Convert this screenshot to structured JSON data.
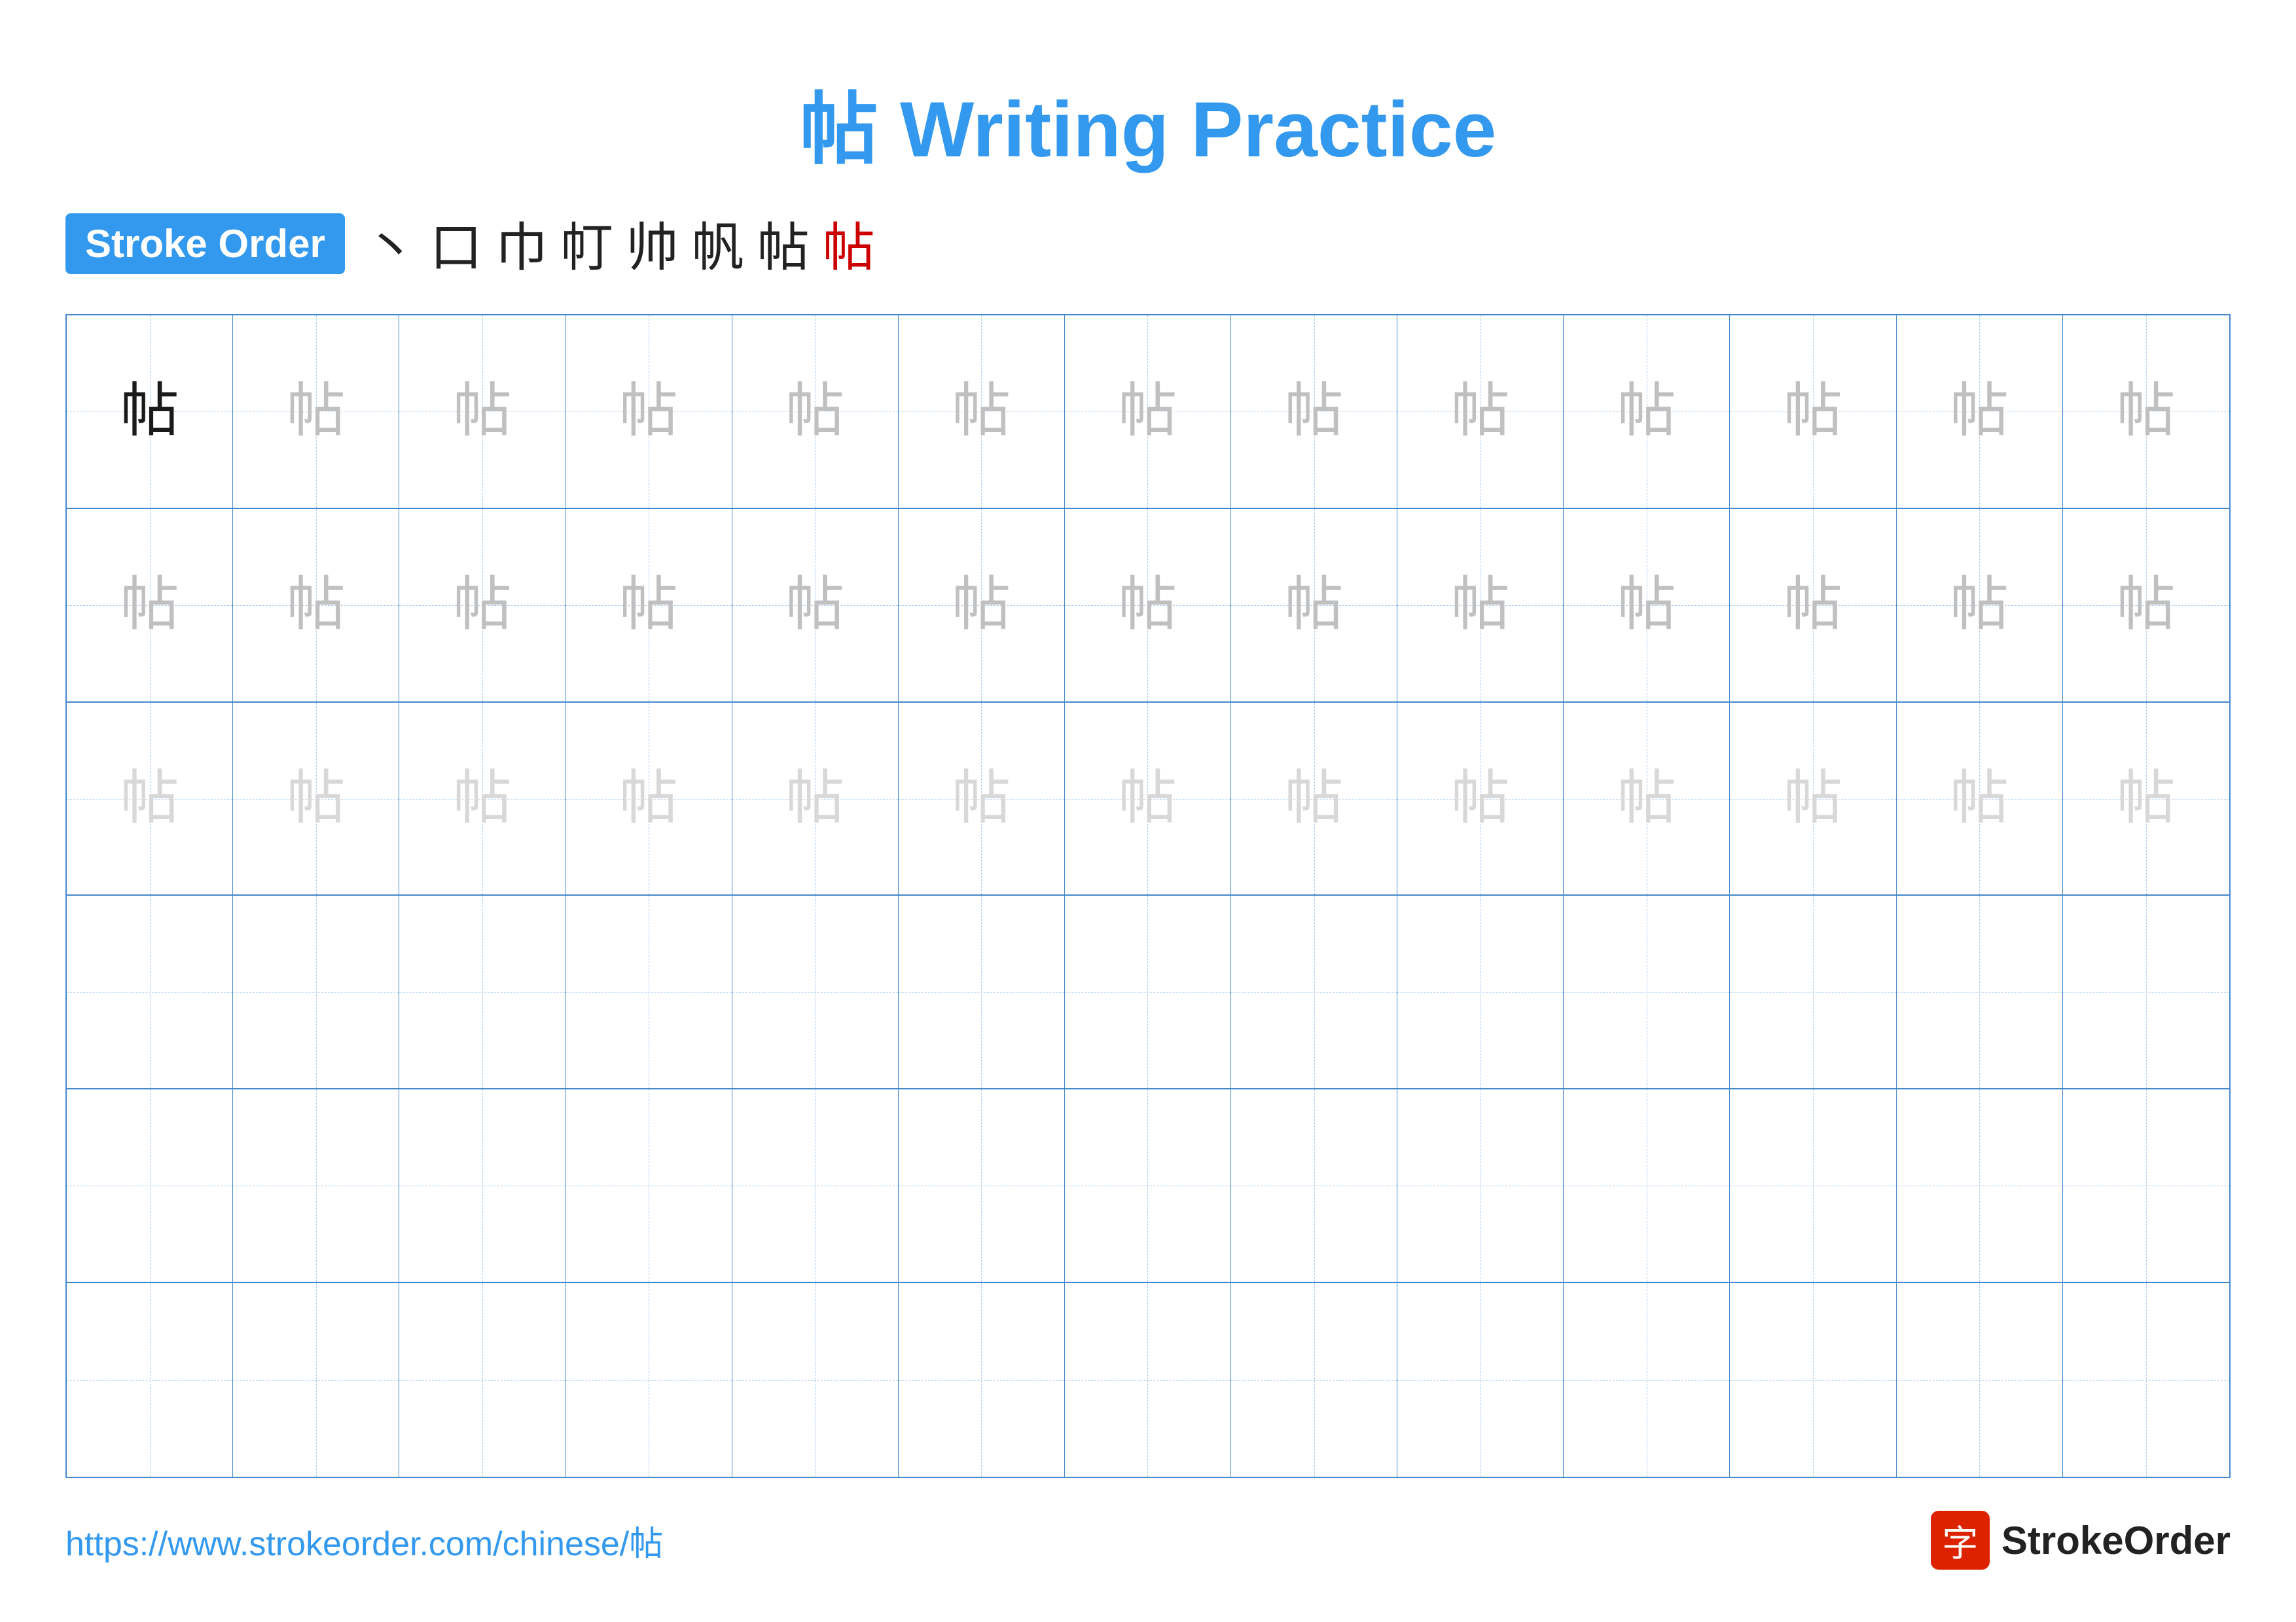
{
  "title": "帖 Writing Practice",
  "strokeOrder": {
    "badge": "Stroke Order",
    "steps": [
      "丶",
      "口",
      "巾",
      "帄",
      "帅",
      "帆",
      "帖",
      "帖"
    ]
  },
  "grid": {
    "rows": 6,
    "cols": 13,
    "cells": [
      [
        "dark",
        "medium",
        "medium",
        "medium",
        "medium",
        "medium",
        "medium",
        "medium",
        "medium",
        "medium",
        "medium",
        "medium",
        "medium"
      ],
      [
        "medium",
        "medium",
        "medium",
        "medium",
        "medium",
        "medium",
        "medium",
        "medium",
        "medium",
        "medium",
        "medium",
        "medium",
        "medium"
      ],
      [
        "light",
        "light",
        "light",
        "light",
        "light",
        "light",
        "light",
        "light",
        "light",
        "light",
        "light",
        "light",
        "light"
      ],
      [
        "empty",
        "empty",
        "empty",
        "empty",
        "empty",
        "empty",
        "empty",
        "empty",
        "empty",
        "empty",
        "empty",
        "empty",
        "empty"
      ],
      [
        "empty",
        "empty",
        "empty",
        "empty",
        "empty",
        "empty",
        "empty",
        "empty",
        "empty",
        "empty",
        "empty",
        "empty",
        "empty"
      ],
      [
        "empty",
        "empty",
        "empty",
        "empty",
        "empty",
        "empty",
        "empty",
        "empty",
        "empty",
        "empty",
        "empty",
        "empty",
        "empty"
      ]
    ],
    "char": "帖"
  },
  "footer": {
    "url": "https://www.strokeorder.com/chinese/帖",
    "logoText": "StrokeOrder",
    "logoChar": "字"
  }
}
